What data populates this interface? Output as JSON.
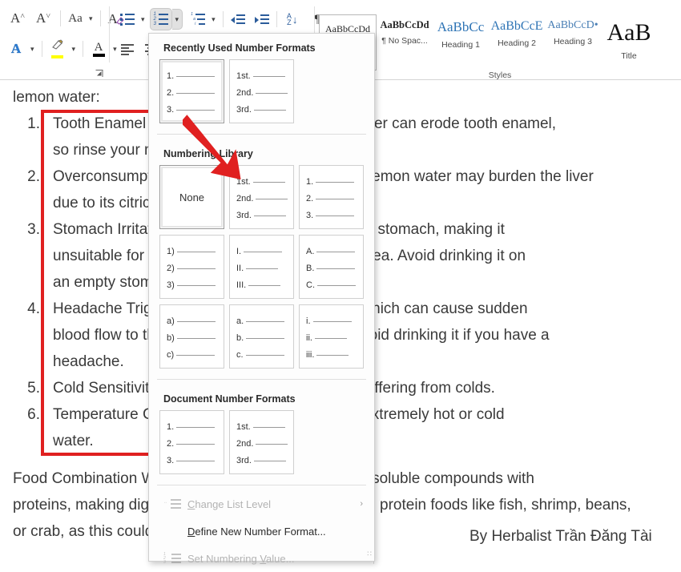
{
  "app": {
    "name": "Microsoft Word"
  },
  "ribbon": {
    "font_group": {
      "buttons": [
        {
          "name": "grow-font",
          "glyph": "A",
          "sup": "˄",
          "tooltip": "Increase Font Size"
        },
        {
          "name": "shrink-font",
          "glyph": "A",
          "sup": "˅",
          "tooltip": "Decrease Font Size"
        },
        {
          "name": "change-case",
          "glyph": "Aa",
          "tooltip": "Change Case"
        },
        {
          "name": "clear-formatting",
          "glyph": "A",
          "tooltip": "Clear All Formatting"
        },
        {
          "name": "text-effects",
          "glyph": "A",
          "tooltip": "Text Effects and Typography"
        },
        {
          "name": "text-highlight-color",
          "glyph": "✎",
          "color": "#ffff00",
          "tooltip": "Text Highlight Color"
        },
        {
          "name": "font-color",
          "glyph": "A",
          "color": "#000000",
          "tooltip": "Font Color"
        }
      ],
      "dialog_launcher": "↘"
    },
    "paragraph_group": {
      "buttons": [
        {
          "name": "bullets",
          "tooltip": "Bullets"
        },
        {
          "name": "numbering",
          "tooltip": "Numbering",
          "active": true
        },
        {
          "name": "multilevel-list",
          "tooltip": "Multilevel List"
        },
        {
          "name": "decrease-indent",
          "tooltip": "Decrease Indent"
        },
        {
          "name": "increase-indent",
          "tooltip": "Increase Indent"
        },
        {
          "name": "sort",
          "top": "A",
          "bottom": "Z",
          "arrow": "↓",
          "tooltip": "Sort"
        },
        {
          "name": "show-formatting-marks",
          "glyph": "¶",
          "tooltip": "Show/Hide ¶"
        },
        {
          "name": "align-left",
          "tooltip": "Align Left"
        },
        {
          "name": "align-center",
          "tooltip": "Center"
        }
      ]
    },
    "styles_group": {
      "label": "Styles",
      "items": [
        {
          "sample": "AaBbCcDd",
          "name": "",
          "selected": true,
          "size": 12,
          "color": "#262626",
          "weight": "normal"
        },
        {
          "sample": "AaBbCcDd",
          "name": "¶ No Spac...",
          "size": 12.5,
          "color": "#262626",
          "weight": "bold"
        },
        {
          "sample": "AaBbCс",
          "name": "Heading 1",
          "size": 17,
          "color": "#2e74b5",
          "weight": "normal"
        },
        {
          "sample": "AaBbCcЕ",
          "name": "Heading 2",
          "size": 16,
          "color": "#2e74b5",
          "weight": "normal"
        },
        {
          "sample": "AaBbCcD•",
          "name": "Heading 3",
          "size": 14,
          "color": "#4a7fb5",
          "weight": "normal"
        },
        {
          "sample": "AaВ",
          "name": "Title",
          "size": 30,
          "color": "#111111",
          "weight": "normal"
        }
      ]
    }
  },
  "numbering_menu": {
    "sections": [
      {
        "key": "recent",
        "heading": "Recently Used Number Formats",
        "tiles": [
          {
            "name": "format-1-2-3",
            "labels": [
              "1.",
              "2.",
              "3."
            ],
            "selected": true
          },
          {
            "name": "format-1st-2nd-3rd",
            "labels": [
              "1st.",
              "2nd.",
              "3rd."
            ],
            "selected": false
          }
        ]
      },
      {
        "key": "library",
        "heading": "Numbering Library",
        "tiles": [
          {
            "name": "format-none",
            "none_label": "None",
            "labels": [],
            "selected": true
          },
          {
            "name": "format-1st-2nd-3rd",
            "labels": [
              "1st.",
              "2nd.",
              "3rd."
            ],
            "selected": false
          },
          {
            "name": "format-1-2-3",
            "labels": [
              "1.",
              "2.",
              "3."
            ],
            "selected": false
          },
          {
            "name": "format-paren-1-2-3",
            "labels": [
              "1)",
              "2)",
              "3)"
            ],
            "selected": false
          },
          {
            "name": "format-roman-upper",
            "labels": [
              "I.",
              "II.",
              "III."
            ],
            "selected": false
          },
          {
            "name": "format-alpha-upper",
            "labels": [
              "A.",
              "B.",
              "C."
            ],
            "selected": false
          },
          {
            "name": "format-paren-alpha-lower",
            "labels": [
              "a)",
              "b)",
              "c)"
            ],
            "selected": false
          },
          {
            "name": "format-alpha-lower",
            "labels": [
              "a.",
              "b.",
              "c."
            ],
            "selected": false
          },
          {
            "name": "format-roman-lower",
            "labels": [
              "i.",
              "ii.",
              "iii."
            ],
            "selected": false
          }
        ]
      },
      {
        "key": "document",
        "heading": "Document Number Formats",
        "tiles": [
          {
            "name": "format-1-2-3",
            "labels": [
              "1.",
              "2.",
              "3."
            ],
            "selected": false
          },
          {
            "name": "format-1st-2nd-3rd",
            "labels": [
              "1st.",
              "2nd.",
              "3rd."
            ],
            "selected": false
          }
        ]
      }
    ],
    "commands": [
      {
        "name": "change-list-level",
        "label": "Change List Level",
        "enabled": false,
        "submenu": true,
        "chevron": "›",
        "icon": "indent-icon"
      },
      {
        "name": "define-new-number-format",
        "label": "Define New Number Format...",
        "enabled": true,
        "submenu": false,
        "icon": null
      },
      {
        "name": "set-numbering-value",
        "label": "Set Numbering Value...",
        "enabled": false,
        "submenu": false,
        "icon": "numbering-edit-icon"
      }
    ],
    "resize_grip": "∷"
  },
  "document": {
    "intro_tail": "lemon water:",
    "list_items": [
      {
        "num": "1.",
        "lines": [
          "Tooth Enamel Erosion: The acidity of lemon water can erode tooth enamel,",
          "so rinse your mouth after drinking."
        ]
      },
      {
        "num": "2.",
        "lines": [
          "Overconsumption and Liver Health: Excessive lemon water may burden the liver",
          "due to its citric acid content."
        ]
      },
      {
        "num": "3.",
        "lines": [
          "Stomach Irritation: Lemon water may irritate the stomach, making it",
          "unsuitable for those with ulcers, reflux, or diarrhea. Avoid drinking it on",
          "an empty stomach."
        ]
      },
      {
        "num": "4.",
        "lines": [
          "Headache Trigger: Lemon contains tyramine, which can cause sudden",
          "blood flow to the brain, triggering migraines. Avoid drinking it if you have a",
          "headache."
        ]
      },
      {
        "num": "5.",
        "lines": [
          "Cold Sensitivity: Not recommended for those suffering from colds."
        ]
      },
      {
        "num": "6.",
        "lines": [
          "Temperature Caution: Avoid lemon water with extremely hot or cold",
          "water."
        ]
      }
    ],
    "closing_lines": [
      "Food Combination Warning: Lemon juice may form insoluble compounds with",
      "proteins, making digestion harder. Avoid pairing it with protein foods like fish, shrimp, beans,",
      "or crab, as this could cause stomach discomfort."
    ],
    "signature": "By Herbalist Trần Đăng Tài"
  },
  "annotations": {
    "highlight_rect_color": "#e02020",
    "arrow_color": "#e02020"
  }
}
